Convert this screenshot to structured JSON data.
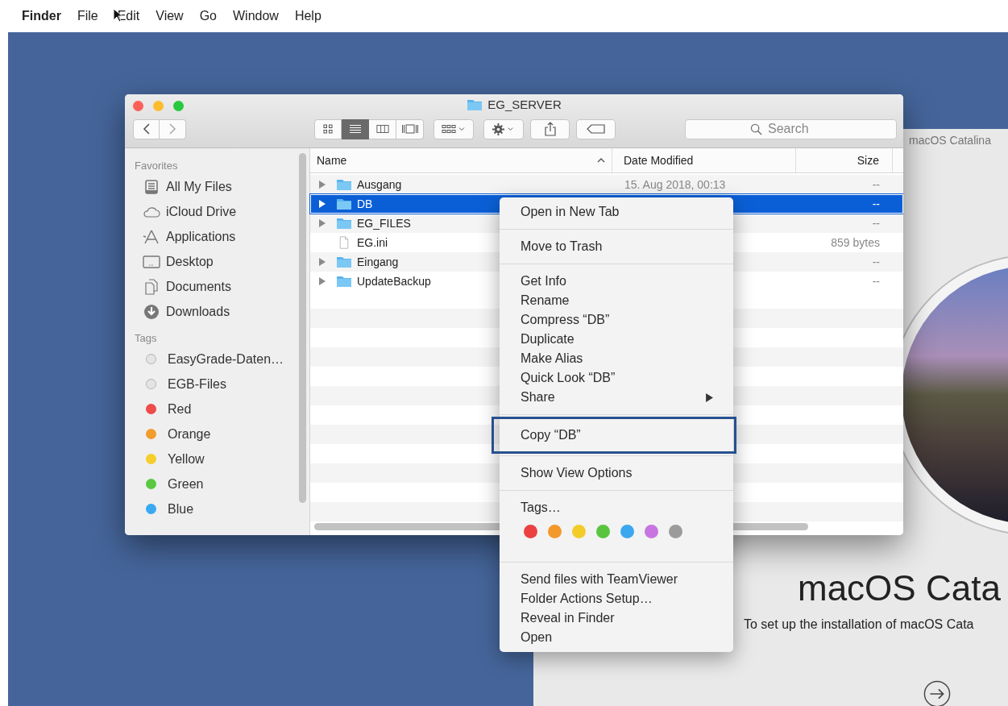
{
  "menu_bar": {
    "items": [
      {
        "label": "Finder",
        "kind": "app"
      },
      {
        "label": "File",
        "kind": "menu"
      },
      {
        "label": "Edit",
        "kind": "menu"
      },
      {
        "label": "View",
        "kind": "menu"
      },
      {
        "label": "Go",
        "kind": "menu"
      },
      {
        "label": "Window",
        "kind": "menu"
      },
      {
        "label": "Help",
        "kind": "menu"
      }
    ]
  },
  "installer": {
    "title": "macOS Catalina",
    "heading": "macOS Cata",
    "subtitle": "To set up the installation of macOS Cata"
  },
  "finder": {
    "title": "EG_SERVER",
    "view_modes": [
      {
        "kind": "icons",
        "selected": false
      },
      {
        "kind": "list",
        "selected": true
      },
      {
        "kind": "columns",
        "selected": false
      },
      {
        "kind": "gallery",
        "selected": false
      }
    ],
    "search": {
      "placeholder": "Search"
    },
    "sidebar": {
      "sections": [
        {
          "heading": "Favorites",
          "kind": "places",
          "items": [
            {
              "label": "All My Files"
            },
            {
              "label": "iCloud Drive"
            },
            {
              "label": "Applications"
            },
            {
              "label": "Desktop"
            },
            {
              "label": "Documents"
            },
            {
              "label": "Downloads"
            }
          ]
        },
        {
          "heading": "Tags",
          "kind": "tags",
          "items": [
            {
              "label": "EasyGrade-Daten…",
              "color": "#e4e4e4"
            },
            {
              "label": "EGB-Files",
              "color": "#e4e4e4"
            },
            {
              "label": "Red",
              "color": "#ee4b4b"
            },
            {
              "label": "Orange",
              "color": "#f39c2e"
            },
            {
              "label": "Yellow",
              "color": "#f5ce2d"
            },
            {
              "label": "Green",
              "color": "#5ac840"
            },
            {
              "label": "Blue",
              "color": "#3aa9f1"
            }
          ]
        }
      ]
    },
    "columns": [
      {
        "label": "Name",
        "sorted": true
      },
      {
        "label": "Date Modified",
        "sorted": false
      },
      {
        "label": "Size",
        "sorted": false
      }
    ],
    "rows": [
      {
        "name": "Ausgang",
        "kind": "folder",
        "date": "15. Aug 2018, 00:13",
        "size": "--",
        "selected": false
      },
      {
        "name": "DB",
        "kind": "folder",
        "size": "--",
        "selected": true
      },
      {
        "name": "EG_FILES",
        "kind": "folder",
        "size": "--",
        "selected": false
      },
      {
        "name": "EG.ini",
        "kind": "file",
        "size": "859 bytes",
        "selected": false
      },
      {
        "name": "Eingang",
        "kind": "folder",
        "size": "--",
        "selected": false
      },
      {
        "name": "UpdateBackup",
        "kind": "folder",
        "size": "--",
        "selected": false
      }
    ]
  },
  "context_menu": {
    "sections": [
      {
        "kind": "items",
        "items": [
          {
            "label": "Open in New Tab",
            "submenu": false,
            "highlighted": false
          }
        ]
      },
      {
        "kind": "items",
        "items": [
          {
            "label": "Move to Trash",
            "submenu": false,
            "highlighted": false
          }
        ]
      },
      {
        "kind": "items",
        "items": [
          {
            "label": "Get Info",
            "submenu": false,
            "highlighted": false
          },
          {
            "label": "Rename",
            "submenu": false,
            "highlighted": false
          },
          {
            "label": "Compress “DB”",
            "submenu": false,
            "highlighted": false
          },
          {
            "label": "Duplicate",
            "submenu": false,
            "highlighted": false
          },
          {
            "label": "Make Alias",
            "submenu": false,
            "highlighted": false
          },
          {
            "label": "Quick Look “DB”",
            "submenu": false,
            "highlighted": false
          },
          {
            "label": "Share",
            "submenu": true,
            "highlighted": false
          }
        ]
      },
      {
        "kind": "items",
        "items": [
          {
            "label": "Copy “DB”",
            "submenu": false,
            "highlighted": true
          }
        ]
      },
      {
        "kind": "items",
        "items": [
          {
            "label": "Show View Options",
            "submenu": false,
            "highlighted": false
          }
        ]
      },
      {
        "kind": "tags",
        "label": "Tags…",
        "colors": [
          {
            "color": "#ec4141"
          },
          {
            "color": "#f3982b"
          },
          {
            "color": "#f3cc2c"
          },
          {
            "color": "#5ac43f"
          },
          {
            "color": "#3aa7ee"
          },
          {
            "color": "#c775e0"
          },
          {
            "color": "#9b9b9b"
          }
        ]
      },
      {
        "kind": "items",
        "items": [
          {
            "label": "Send files with TeamViewer",
            "submenu": false,
            "highlighted": false
          },
          {
            "label": "Folder Actions Setup…",
            "submenu": false,
            "highlighted": false
          },
          {
            "label": "Reveal in Finder",
            "submenu": false,
            "highlighted": false
          },
          {
            "label": "Open",
            "submenu": false,
            "highlighted": false
          }
        ]
      }
    ]
  }
}
